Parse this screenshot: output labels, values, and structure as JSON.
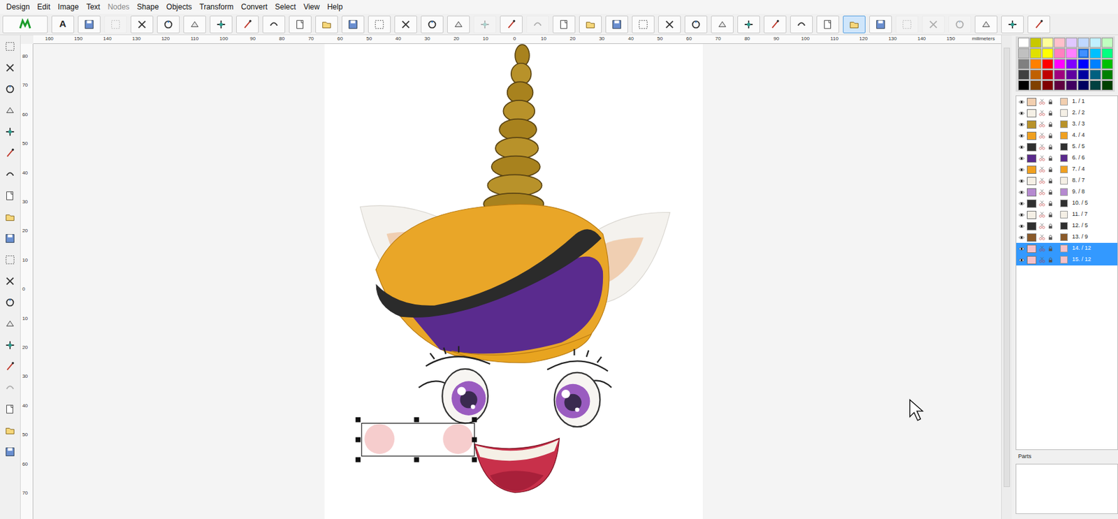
{
  "menu": [
    {
      "label": "Design",
      "disabled": false
    },
    {
      "label": "Edit",
      "disabled": false
    },
    {
      "label": "Image",
      "disabled": false
    },
    {
      "label": "Text",
      "disabled": false
    },
    {
      "label": "Nodes",
      "disabled": true
    },
    {
      "label": "Shape",
      "disabled": false
    },
    {
      "label": "Objects",
      "disabled": false
    },
    {
      "label": "Transform",
      "disabled": false
    },
    {
      "label": "Convert",
      "disabled": false
    },
    {
      "label": "Select",
      "disabled": false
    },
    {
      "label": "View",
      "disabled": false
    },
    {
      "label": "Help",
      "disabled": false
    }
  ],
  "toolbar": [
    {
      "disabled": false,
      "pressed": false
    },
    {
      "text": "A",
      "disabled": false,
      "pressed": false
    },
    {
      "disabled": false,
      "pressed": false
    },
    {
      "disabled": true,
      "pressed": false
    },
    {
      "disabled": false,
      "pressed": false
    },
    {
      "disabled": false,
      "pressed": false
    },
    {
      "disabled": false,
      "pressed": false
    },
    {
      "disabled": false,
      "pressed": false
    },
    {
      "disabled": false,
      "pressed": false
    },
    {
      "disabled": false,
      "pressed": false
    },
    {
      "disabled": false,
      "pressed": false
    },
    {
      "disabled": false,
      "pressed": false
    },
    {
      "disabled": false,
      "pressed": false
    },
    {
      "disabled": false,
      "pressed": false
    },
    {
      "disabled": false,
      "pressed": false
    },
    {
      "disabled": false,
      "pressed": false
    },
    {
      "disabled": false,
      "pressed": false
    },
    {
      "disabled": true,
      "pressed": false
    },
    {
      "disabled": false,
      "pressed": false
    },
    {
      "disabled": true,
      "pressed": false
    },
    {
      "disabled": false,
      "pressed": false
    },
    {
      "disabled": false,
      "pressed": false
    },
    {
      "disabled": false,
      "pressed": false
    },
    {
      "disabled": false,
      "pressed": false
    },
    {
      "disabled": false,
      "pressed": false
    },
    {
      "disabled": false,
      "pressed": false
    },
    {
      "disabled": false,
      "pressed": false
    },
    {
      "disabled": false,
      "pressed": false
    },
    {
      "disabled": false,
      "pressed": false
    },
    {
      "disabled": false,
      "pressed": false
    },
    {
      "disabled": false,
      "pressed": false
    },
    {
      "disabled": false,
      "pressed": true
    },
    {
      "disabled": false,
      "pressed": false
    },
    {
      "disabled": true,
      "pressed": false
    },
    {
      "disabled": true,
      "pressed": false
    },
    {
      "disabled": true,
      "pressed": false
    },
    {
      "disabled": false,
      "pressed": false
    },
    {
      "disabled": false,
      "pressed": false
    },
    {
      "disabled": false,
      "pressed": false
    }
  ],
  "tools": [
    {
      "disabled": false
    },
    {
      "disabled": false
    },
    {
      "disabled": false
    },
    {
      "disabled": false
    },
    {
      "disabled": false
    },
    {
      "disabled": false
    },
    {
      "disabled": false
    },
    {
      "disabled": false
    },
    {
      "disabled": false
    },
    {
      "disabled": false
    },
    {
      "disabled": false
    },
    {
      "disabled": false
    },
    {
      "disabled": false
    },
    {
      "disabled": false
    },
    {
      "disabled": false
    },
    {
      "disabled": false
    },
    {
      "disabled": true
    },
    {
      "disabled": false
    },
    {
      "disabled": false
    },
    {
      "disabled": false
    }
  ],
  "ruler": {
    "horizontal": [
      "160",
      "150",
      "140",
      "130",
      "120",
      "110",
      "100",
      "90",
      "80",
      "70",
      "60",
      "50",
      "40",
      "30",
      "20",
      "10",
      "0",
      "10",
      "20",
      "30",
      "40",
      "50",
      "60",
      "70",
      "80",
      "90",
      "100",
      "110",
      "120",
      "130",
      "140",
      "150"
    ],
    "vertical": [
      "80",
      "70",
      "60",
      "50",
      "40",
      "30",
      "20",
      "10",
      "0",
      "10",
      "20",
      "30",
      "40",
      "50",
      "60",
      "70"
    ],
    "unit": "milimeters"
  },
  "palette": [
    {
      "color": "#ffffff",
      "selected": false
    },
    {
      "color": "#c8c800",
      "selected": false
    },
    {
      "color": "#ffff99",
      "selected": false
    },
    {
      "color": "#ffc0cb",
      "selected": false
    },
    {
      "color": "#e0c8ff",
      "selected": false
    },
    {
      "color": "#c0d8ff",
      "selected": false
    },
    {
      "color": "#c0f0ff",
      "selected": false
    },
    {
      "color": "#c0ffc0",
      "selected": false
    },
    {
      "color": "#c0c0c0",
      "selected": false
    },
    {
      "color": "#e0e000",
      "selected": false
    },
    {
      "color": "#ffff00",
      "selected": false
    },
    {
      "color": "#ff80c0",
      "selected": false
    },
    {
      "color": "#ff80ff",
      "selected": false
    },
    {
      "color": "#4090ff",
      "selected": true
    },
    {
      "color": "#00c0ff",
      "selected": false
    },
    {
      "color": "#00ff80",
      "selected": false
    },
    {
      "color": "#808080",
      "selected": false
    },
    {
      "color": "#ff8000",
      "selected": false
    },
    {
      "color": "#ff0000",
      "selected": false
    },
    {
      "color": "#ff00ff",
      "selected": false
    },
    {
      "color": "#8000ff",
      "selected": false
    },
    {
      "color": "#0000ff",
      "selected": false
    },
    {
      "color": "#0080ff",
      "selected": false
    },
    {
      "color": "#00c000",
      "selected": false
    },
    {
      "color": "#404040",
      "selected": false
    },
    {
      "color": "#c06000",
      "selected": false
    },
    {
      "color": "#c00000",
      "selected": false
    },
    {
      "color": "#a00080",
      "selected": false
    },
    {
      "color": "#6000a0",
      "selected": false
    },
    {
      "color": "#0000a0",
      "selected": false
    },
    {
      "color": "#006080",
      "selected": false
    },
    {
      "color": "#008000",
      "selected": false
    },
    {
      "color": "#000000",
      "selected": false
    },
    {
      "color": "#804000",
      "selected": false
    },
    {
      "color": "#800000",
      "selected": false
    },
    {
      "color": "#600040",
      "selected": false
    },
    {
      "color": "#400060",
      "selected": false
    },
    {
      "color": "#000060",
      "selected": false
    },
    {
      "color": "#004040",
      "selected": false
    },
    {
      "color": "#004000",
      "selected": false
    }
  ],
  "objects": [
    {
      "label": "1. / 1",
      "color": "#f2cfb0",
      "selected": false,
      "visible": true
    },
    {
      "label": "2. / 2",
      "color": "#f5f0e6",
      "selected": false,
      "visible": true
    },
    {
      "label": "3. / 3",
      "color": "#b8922a",
      "selected": false,
      "visible": true
    },
    {
      "label": "4. / 4",
      "color": "#f0a020",
      "selected": false,
      "visible": true
    },
    {
      "label": "5. / 5",
      "color": "#303030",
      "selected": false,
      "visible": true
    },
    {
      "label": "6. / 6",
      "color": "#5a2a8c",
      "selected": false,
      "visible": true
    },
    {
      "label": "7. / 4",
      "color": "#f0a020",
      "selected": false,
      "visible": true
    },
    {
      "label": "8. / 7",
      "color": "#f5f0e6",
      "selected": false,
      "visible": true
    },
    {
      "label": "9. / 8",
      "color": "#b58ad0",
      "selected": false,
      "visible": true
    },
    {
      "label": "10. / 5",
      "color": "#303030",
      "selected": false,
      "visible": true
    },
    {
      "label": "11. / 7",
      "color": "#f5f0e6",
      "selected": false,
      "visible": true
    },
    {
      "label": "12. / 5",
      "color": "#303030",
      "selected": false,
      "visible": true
    },
    {
      "label": "13. / 9",
      "color": "#8a5a2a",
      "selected": false,
      "visible": true
    },
    {
      "label": "14. / 12",
      "color": "#f5c0c8",
      "selected": true,
      "visible": true
    },
    {
      "label": "15. / 12",
      "color": "#f5c0c8",
      "selected": true,
      "visible": true
    }
  ],
  "parts": {
    "title": "Parts"
  }
}
